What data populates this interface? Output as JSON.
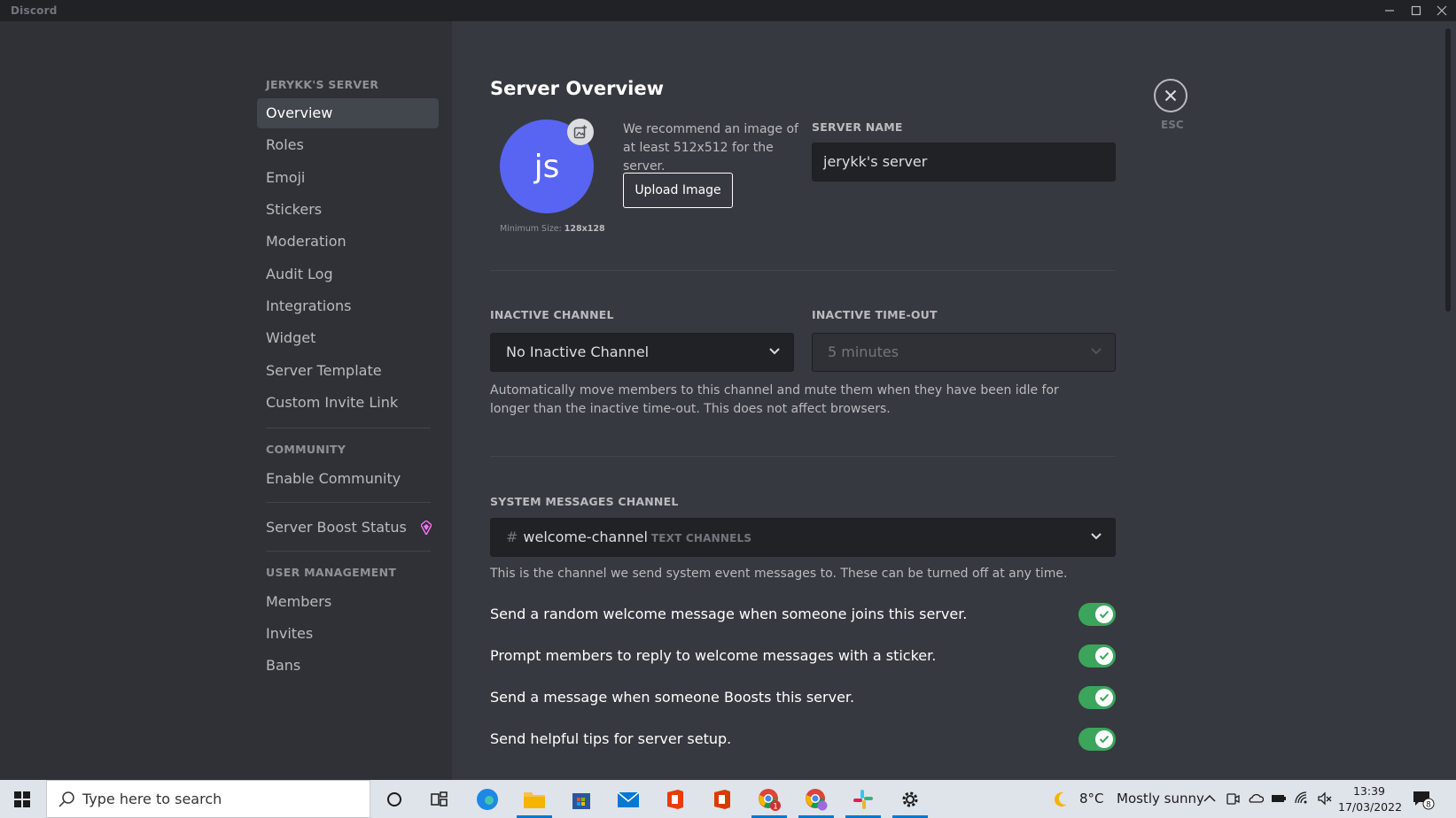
{
  "window": {
    "title": "Discord",
    "controls": [
      "minimize",
      "maximize",
      "close"
    ]
  },
  "sidebar": {
    "server_header": "JERYKK'S SERVER",
    "items": [
      {
        "label": "Overview",
        "active": true
      },
      {
        "label": "Roles"
      },
      {
        "label": "Emoji"
      },
      {
        "label": "Stickers"
      },
      {
        "label": "Moderation"
      },
      {
        "label": "Audit Log"
      },
      {
        "label": "Integrations"
      },
      {
        "label": "Widget"
      },
      {
        "label": "Server Template"
      },
      {
        "label": "Custom Invite Link"
      }
    ],
    "community_header": "COMMUNITY",
    "community_items": [
      {
        "label": "Enable Community"
      }
    ],
    "boost_item": {
      "label": "Server Boost Status",
      "icon": "boost-gem-icon"
    },
    "user_mgmt_header": "USER MANAGEMENT",
    "user_mgmt_items": [
      {
        "label": "Members"
      },
      {
        "label": "Invites"
      },
      {
        "label": "Bans"
      }
    ]
  },
  "main": {
    "title": "Server Overview",
    "avatar": {
      "initials": "js",
      "min_size_label": "Minimum Size:",
      "min_size_value": "128x128"
    },
    "recommend_text": "We recommend an image of at least 512x512 for the server.",
    "upload_button": "Upload Image",
    "server_name_label": "SERVER NAME",
    "server_name_value": "jerykk's server",
    "inactive_channel_label": "INACTIVE CHANNEL",
    "inactive_channel_value": "No Inactive Channel",
    "inactive_timeout_label": "INACTIVE TIME-OUT",
    "inactive_timeout_value": "5 minutes",
    "inactive_desc": "Automatically move members to this channel and mute them when they have been idle for longer than the inactive time-out. This does not affect browsers.",
    "system_channel_label": "SYSTEM MESSAGES CHANNEL",
    "system_channel": {
      "hash": "#",
      "name": "welcome-channel",
      "category": "TEXT CHANNELS"
    },
    "system_desc": "This is the channel we send system event messages to. These can be turned off at any time.",
    "toggles": [
      {
        "label": "Send a random welcome message when someone joins this server.",
        "on": true
      },
      {
        "label": "Prompt members to reply to welcome messages with a sticker.",
        "on": true
      },
      {
        "label": "Send a message when someone Boosts this server.",
        "on": true
      },
      {
        "label": "Send helpful tips for server setup.",
        "on": true
      }
    ],
    "close_label": "ESC"
  },
  "taskbar": {
    "search_placeholder": "Type here to search",
    "weather_temp": "8°C",
    "weather_desc": "Mostly sunny",
    "time": "13:39",
    "date": "17/03/2022",
    "notification_count": "8",
    "chrome_badge": "1"
  },
  "colors": {
    "accent": "#5865f2",
    "toggle_on": "#3ba55c",
    "sidebar_bg": "#2f3136",
    "content_bg": "#36393f"
  }
}
